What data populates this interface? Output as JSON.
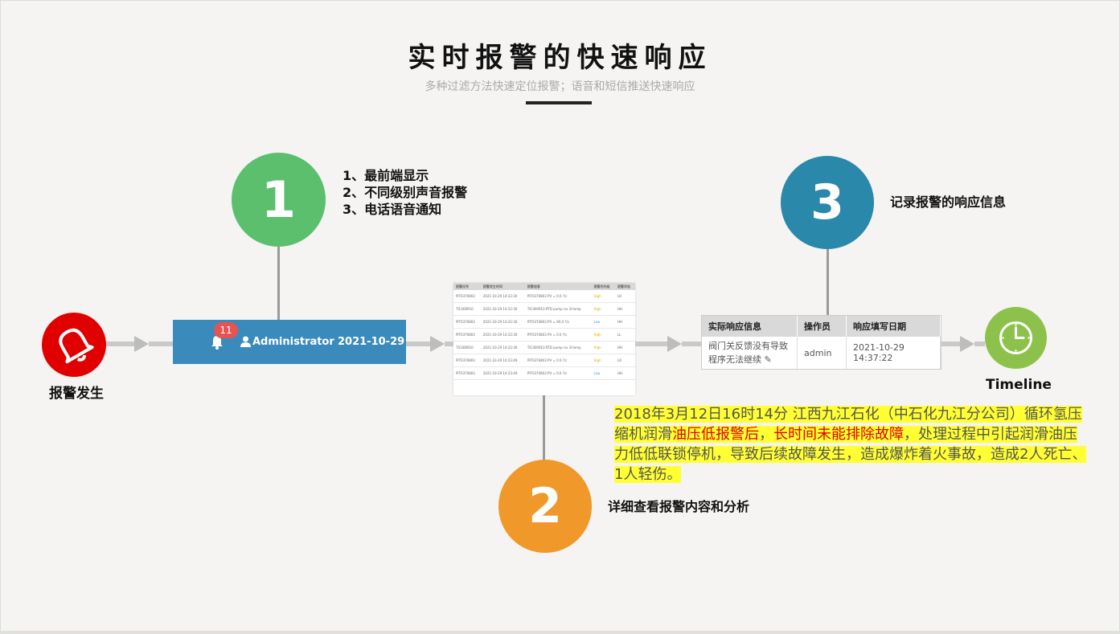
{
  "title": "实时报警的快速响应",
  "subtitle": "多种过滤方法快速定位报警；语音和短信推送快速响应",
  "colors": {
    "step1": "#5bbf6e",
    "step2": "#f0982a",
    "step3": "#2a88aa",
    "alarm": "#e00000",
    "timeline": "#8cc24b",
    "admin_bar": "#3a8bbb",
    "highlight": "#ffff33"
  },
  "alarm": {
    "label": "报警发生",
    "icon": "bell-icon"
  },
  "step1": {
    "number": "1",
    "notes": [
      "1、最前端显示",
      "2、不同级别声音报警",
      "3、电话语音通知"
    ]
  },
  "admin_bar": {
    "badge": "11",
    "user": "Administrator",
    "date": "2021-10-29"
  },
  "step2": {
    "number": "2",
    "note": "详细查看报警内容和分析"
  },
  "step3": {
    "number": "3",
    "note": "记录报警的响应信息"
  },
  "mini_table": {
    "headers": [
      "报警位号",
      "报警发生时间",
      "报警信息",
      "报警优先级",
      "报警状态"
    ],
    "rows": [
      [
        "PIT0370803",
        "2021-10-29 14:22:30",
        "PIT0370803 PV = 0.0 ?/c",
        "High",
        "LO"
      ],
      [
        "TIC400910",
        "2021-10-29 14:22:30",
        "TIC400910 RTD pump no. 8 temp",
        "High",
        "HH"
      ],
      [
        "PIT0370803",
        "2021-10-29 14:22:30",
        "PIT0370803 PV = 90.0 ?/c",
        "Low",
        "HH"
      ],
      [
        "PIT0370803",
        "2021-10-29 14:22:30",
        "PIT0370803 PV = 0.0 ?/c",
        "High",
        "LL"
      ],
      [
        "TIC400910",
        "2021-10-29 14:22:30",
        "TIC400910 RTD pump no. 8 temp",
        "High",
        "HH"
      ],
      [
        "PIT0370803",
        "2021-10-29 14:23:49",
        "PIT0370803 PV = 0.0 ?/c",
        "High",
        "LO"
      ],
      [
        "PIT0370803",
        "2021-10-29 14:23:49",
        "PIT0370803 PV = 0.0 ?/c",
        "Low",
        "HH"
      ]
    ]
  },
  "response_table": {
    "headers": [
      "实际响应信息",
      "操作员",
      "响应填写日期"
    ],
    "row": [
      "阀门关反馈没有导致程序无法继续 ✎",
      "admin",
      "2021-10-29 14:37:22"
    ]
  },
  "timeline": {
    "label": "Timeline",
    "icon": "clock-icon"
  },
  "story": {
    "part1": "2018年3月12日16时14分 江西九江石化（中石化九江分公司）循环氢压缩机润滑",
    "red1": "油压低报警后",
    "sep": "，",
    "red2": "长时间未能排除故障",
    "part2": "，处理过程中引起润滑油压力低低联锁停机，导致后续故障发生，造成爆炸着火事故，造成2人死亡、1人轻伤。"
  }
}
